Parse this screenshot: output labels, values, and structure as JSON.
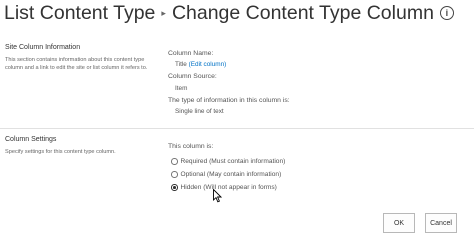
{
  "header": {
    "crumb": "List Content Type",
    "separator": "▸",
    "title": "Change Content Type Column",
    "info_icon": "i"
  },
  "site_column_info": {
    "heading": "Site Column Information",
    "description": "This section contains information about this content type column and a link to edit the site or list column it refers to.",
    "column_name_label": "Column Name:",
    "column_name_value": "Title",
    "edit_link": "(Edit column)",
    "column_source_label": "Column Source:",
    "column_source_value": "Item",
    "type_label": "The type of information in this column is:",
    "type_value": "Single line of text"
  },
  "column_settings": {
    "heading": "Column Settings",
    "description": "Specify settings for this content type column.",
    "this_column_is": "This column is:",
    "options": [
      {
        "label": "Required (Must contain information)",
        "checked": false
      },
      {
        "label": "Optional (May contain information)",
        "checked": false
      },
      {
        "label": "Hidden (Will not appear in forms)",
        "checked": true
      }
    ]
  },
  "buttons": {
    "ok": "OK",
    "cancel": "Cancel"
  }
}
